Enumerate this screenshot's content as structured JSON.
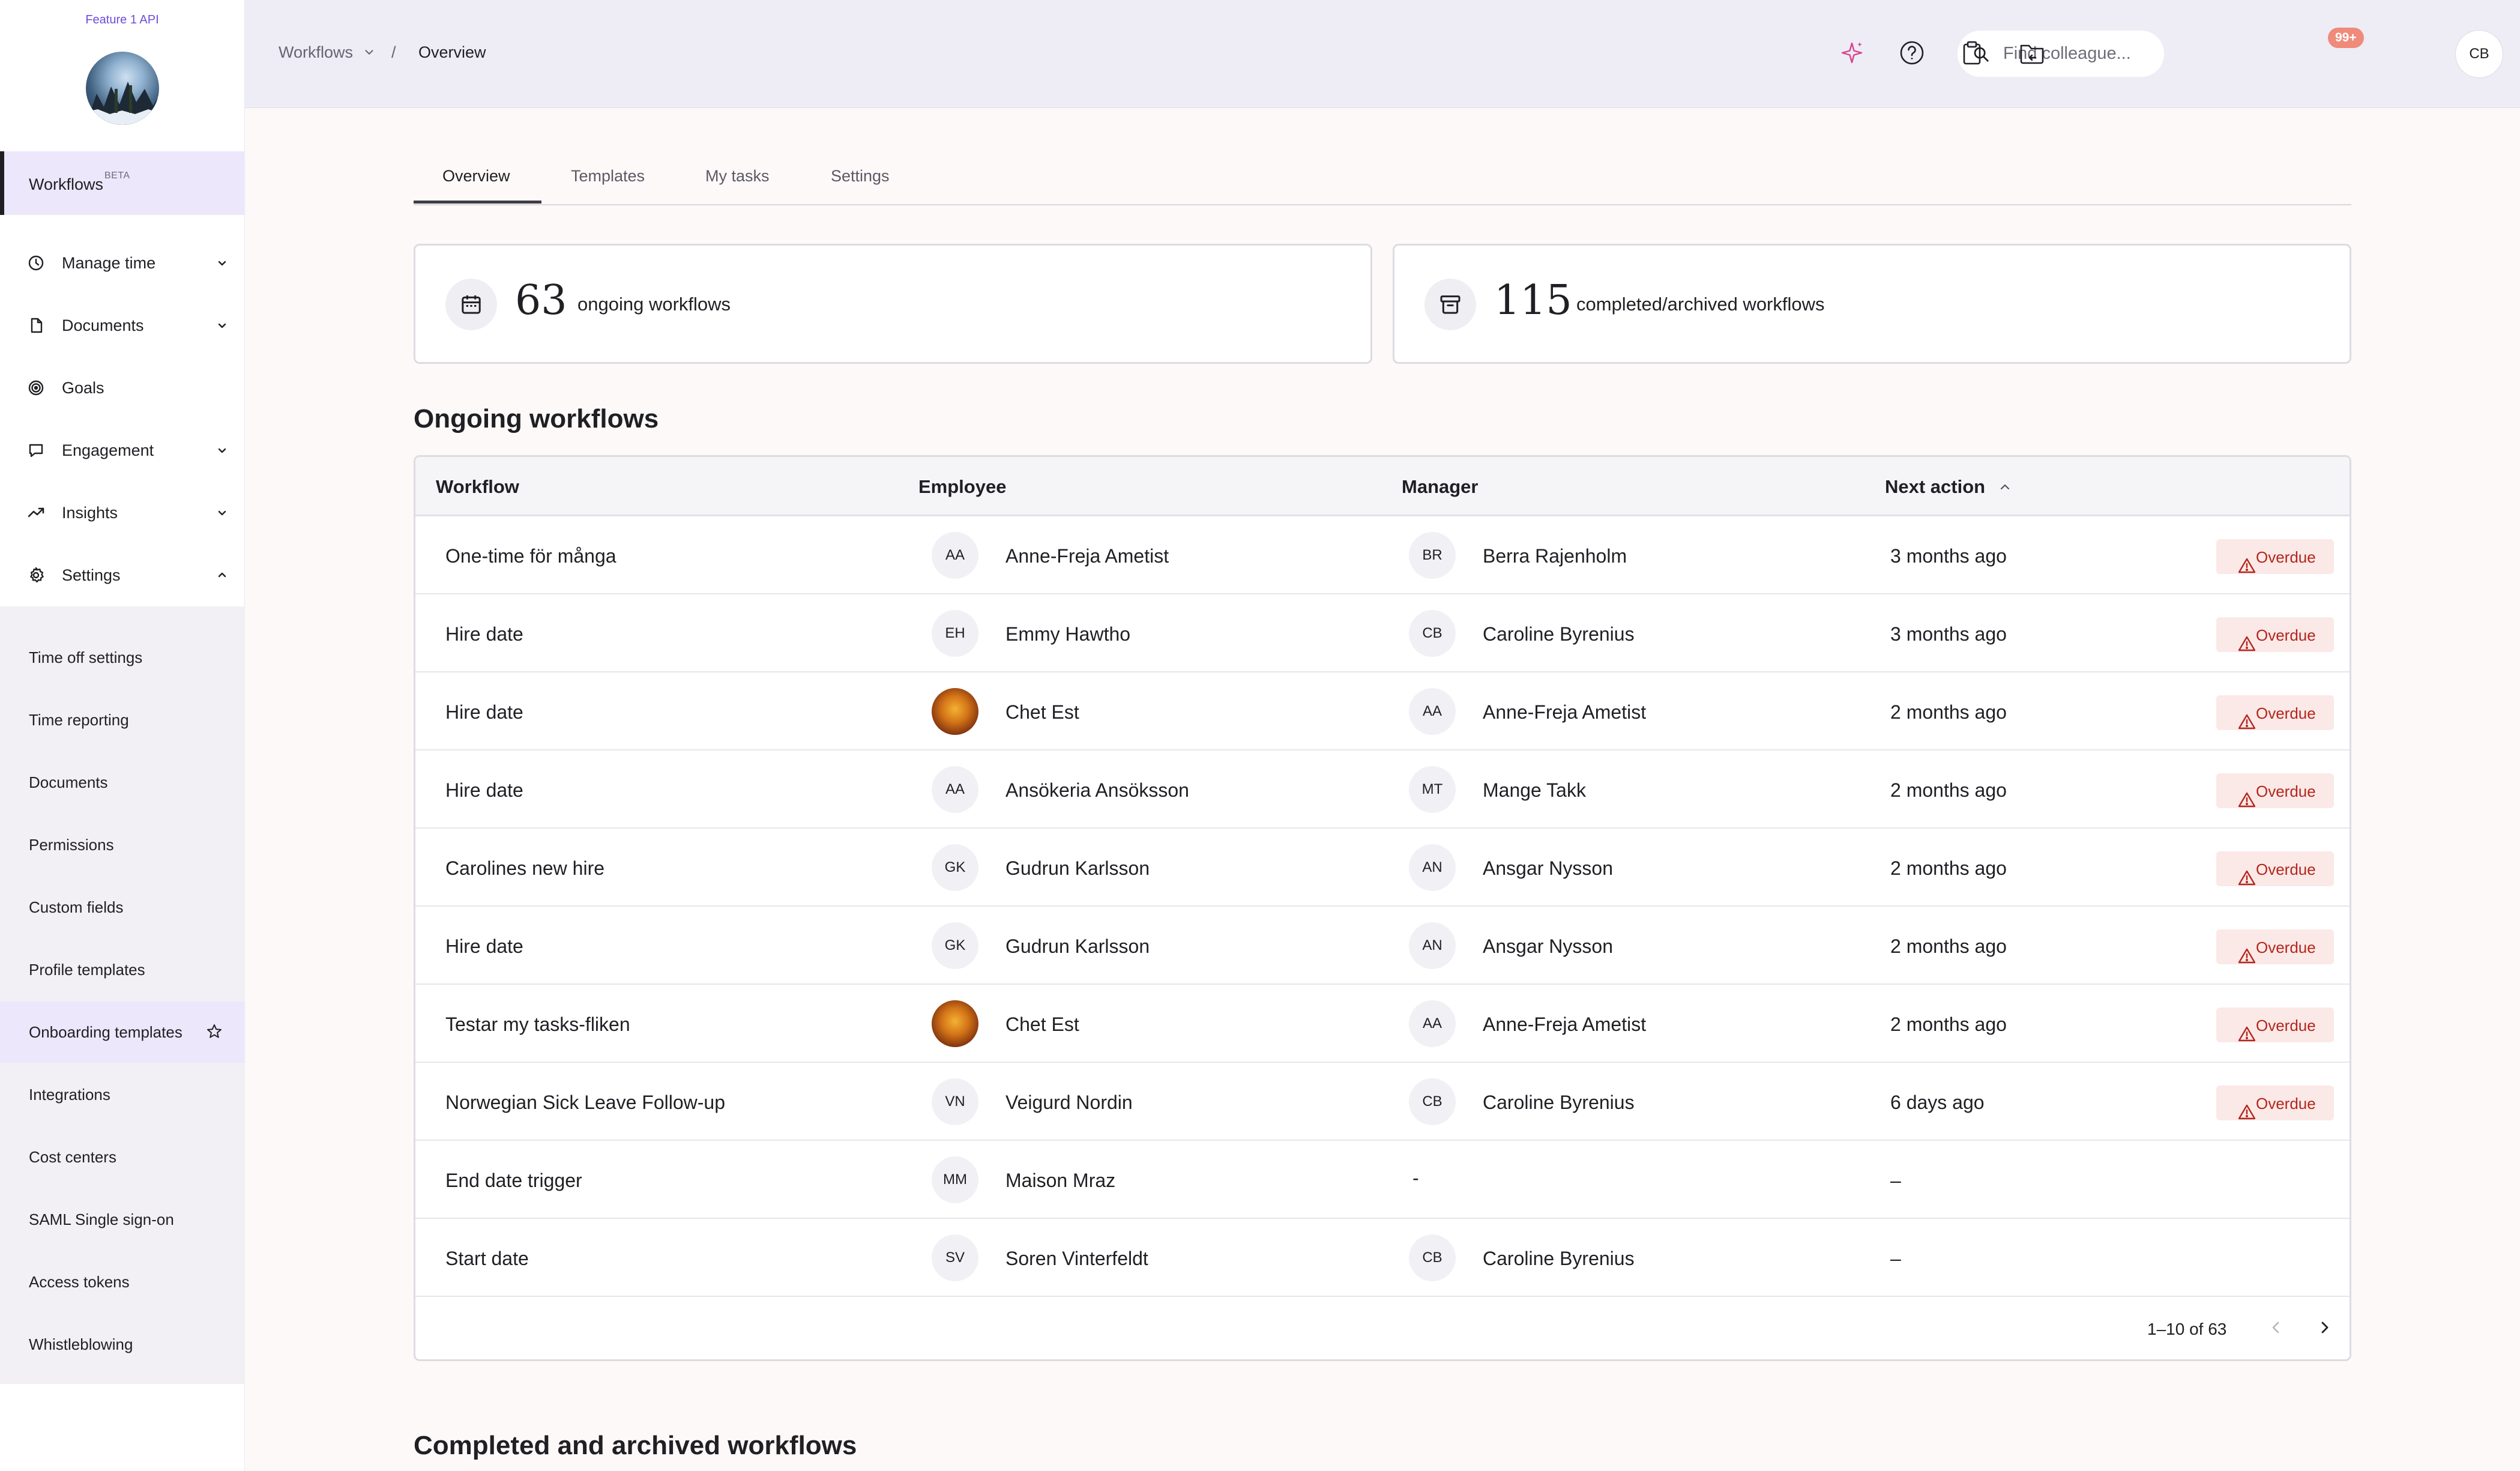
{
  "sidebar": {
    "brand_name": "Feature 1 API",
    "active_item": {
      "label": "Workflows",
      "badge": "BETA"
    },
    "items": [
      {
        "label": "Manage time",
        "icon": "clock-icon",
        "chevron": "down"
      },
      {
        "label": "Documents",
        "icon": "document-icon",
        "chevron": "down"
      },
      {
        "label": "Goals",
        "icon": "target-icon",
        "chevron": "none"
      },
      {
        "label": "Engagement",
        "icon": "chat-icon",
        "chevron": "down"
      },
      {
        "label": "Insights",
        "icon": "trending-up-icon",
        "chevron": "down"
      },
      {
        "label": "Settings",
        "icon": "gear-icon",
        "chevron": "up"
      }
    ],
    "settings_subitems": [
      {
        "label": "Time off settings"
      },
      {
        "label": "Time reporting"
      },
      {
        "label": "Documents"
      },
      {
        "label": "Permissions"
      },
      {
        "label": "Custom fields"
      },
      {
        "label": "Profile templates"
      },
      {
        "label": "Onboarding templates",
        "highlighted": true,
        "icon": "star-icon"
      },
      {
        "label": "Integrations"
      },
      {
        "label": "Cost centers"
      },
      {
        "label": "SAML Single sign-on"
      },
      {
        "label": "Access tokens"
      },
      {
        "label": "Whistleblowing"
      }
    ]
  },
  "topbar": {
    "breadcrumb": {
      "parent": "Workflows",
      "separator": "/",
      "current": "Overview"
    },
    "search": {
      "placeholder": "Find colleague...",
      "value": ""
    },
    "icons": [
      "sparkle-icon",
      "help-icon",
      "clipboard-icon",
      "folder-return-icon"
    ],
    "notification_badge": "99+",
    "user_initials": "CB"
  },
  "tabs": [
    {
      "label": "Overview",
      "active": true
    },
    {
      "label": "Templates",
      "active": false
    },
    {
      "label": "My tasks",
      "active": false
    },
    {
      "label": "Settings",
      "active": false
    }
  ],
  "stats": {
    "ongoing": {
      "count": "63",
      "label": "ongoing workflows",
      "icon": "calendar-icon"
    },
    "completed": {
      "count": "115",
      "label": "completed/archived workflows",
      "icon": "archive-icon"
    }
  },
  "ongoing_section": {
    "title": "Ongoing workflows",
    "columns": {
      "workflow": "Workflow",
      "employee": "Employee",
      "manager": "Manager",
      "next_action": "Next action"
    },
    "rows": [
      {
        "workflow": "One-time för många",
        "employee": {
          "name": "Anne-Freja Ametist",
          "initials": "AA",
          "photo": false
        },
        "manager": {
          "name": "Berra Rajenholm",
          "initials": "BR"
        },
        "next_action": "3 months ago",
        "status": "Overdue"
      },
      {
        "workflow": "Hire date",
        "employee": {
          "name": "Emmy Hawtho",
          "initials": "EH",
          "photo": false
        },
        "manager": {
          "name": "Caroline Byrenius",
          "initials": "CB"
        },
        "next_action": "3 months ago",
        "status": "Overdue"
      },
      {
        "workflow": "Hire date",
        "employee": {
          "name": "Chet Est",
          "initials": "",
          "photo": true
        },
        "manager": {
          "name": "Anne-Freja Ametist",
          "initials": "AA"
        },
        "next_action": "2 months ago",
        "status": "Overdue"
      },
      {
        "workflow": "Hire date",
        "employee": {
          "name": "Ansökeria Ansöksson",
          "initials": "AA",
          "photo": false
        },
        "manager": {
          "name": "Mange Takk",
          "initials": "MT"
        },
        "next_action": "2 months ago",
        "status": "Overdue"
      },
      {
        "workflow": "Carolines new hire",
        "employee": {
          "name": "Gudrun Karlsson",
          "initials": "GK",
          "photo": false
        },
        "manager": {
          "name": "Ansgar Nysson",
          "initials": "AN"
        },
        "next_action": "2 months ago",
        "status": "Overdue"
      },
      {
        "workflow": "Hire date",
        "employee": {
          "name": "Gudrun Karlsson",
          "initials": "GK",
          "photo": false
        },
        "manager": {
          "name": "Ansgar Nysson",
          "initials": "AN"
        },
        "next_action": "2 months ago",
        "status": "Overdue"
      },
      {
        "workflow": "Testar my tasks-fliken",
        "employee": {
          "name": "Chet Est",
          "initials": "",
          "photo": true
        },
        "manager": {
          "name": "Anne-Freja Ametist",
          "initials": "AA"
        },
        "next_action": "2 months ago",
        "status": "Overdue"
      },
      {
        "workflow": "Norwegian Sick Leave Follow-up",
        "employee": {
          "name": "Veigurd Nordin",
          "initials": "VN",
          "photo": false
        },
        "manager": {
          "name": "Caroline Byrenius",
          "initials": "CB"
        },
        "next_action": "6 days ago",
        "status": "Overdue"
      },
      {
        "workflow": "End date trigger",
        "employee": {
          "name": "Maison Mraz",
          "initials": "MM",
          "photo": false
        },
        "manager": null,
        "manager_empty": "-",
        "next_action": "–",
        "status": ""
      },
      {
        "workflow": "Start date",
        "employee": {
          "name": "Soren Vinterfeldt",
          "initials": "SV",
          "photo": false
        },
        "manager": {
          "name": "Caroline Byrenius",
          "initials": "CB"
        },
        "next_action": "–",
        "status": ""
      }
    ],
    "pagination": "1–10 of 63"
  },
  "completed_section": {
    "title": "Completed and archived workflows"
  },
  "colors": {
    "accent": "#6d4dd8",
    "active_nav_bg": "#ece7fb",
    "overdue_bg": "#fbe9e7",
    "overdue_text": "#b3261e",
    "badge": "#f08a7a",
    "sparkle": "#d9428f"
  }
}
